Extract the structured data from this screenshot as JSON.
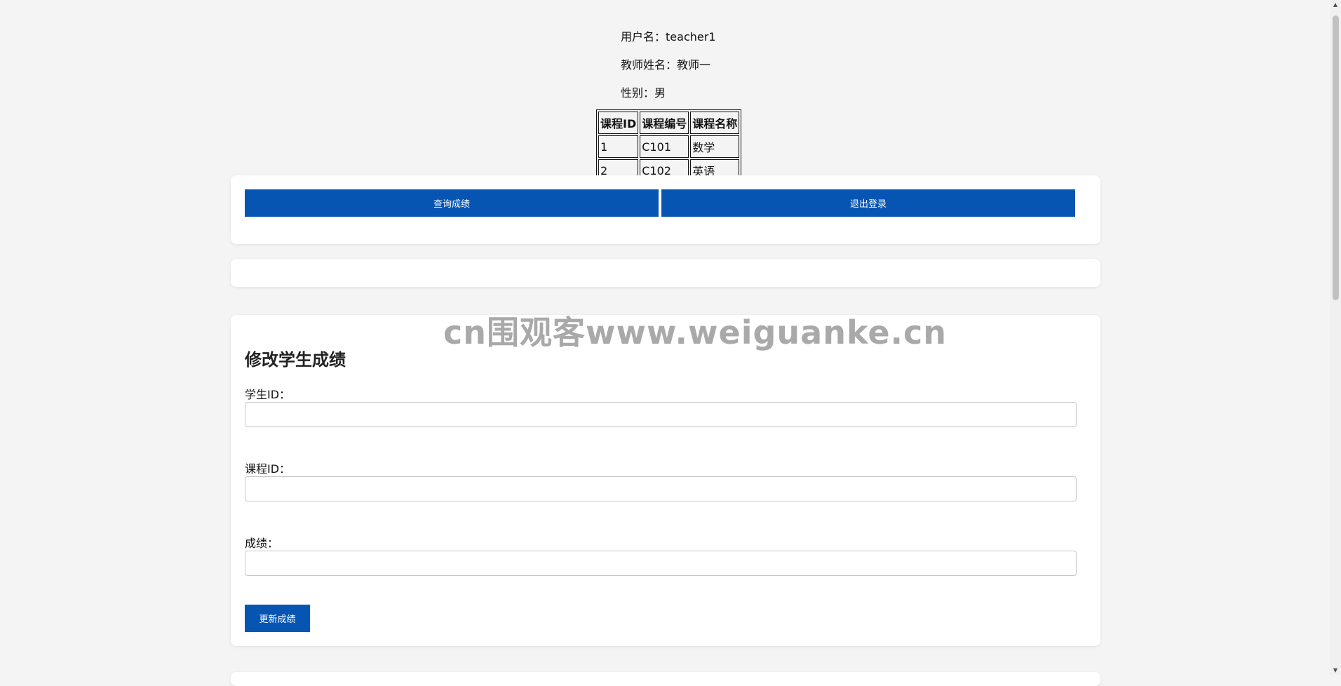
{
  "user": {
    "username_label": "用户名：",
    "username": "teacher1",
    "teacher_name_label": "教师姓名：",
    "teacher_name": "教师一",
    "gender_label": "性别：",
    "gender": "男"
  },
  "courses": {
    "headers": [
      "课程ID",
      "课程编号",
      "课程名称"
    ],
    "rows": [
      [
        "1",
        "C101",
        "数学"
      ],
      [
        "2",
        "C102",
        "英语"
      ]
    ]
  },
  "actions": {
    "query_label": "查询成绩",
    "logout_label": "退出登录"
  },
  "form": {
    "title": "修改学生成绩",
    "student_id_label": "学生ID：",
    "course_id_label": "课程ID：",
    "score_label": "成绩：",
    "student_id_value": "",
    "course_id_value": "",
    "score_value": "",
    "submit_label": "更新成绩"
  },
  "watermark": "cn围观客www.weiguanke.cn",
  "colors": {
    "accent": "#0755b3",
    "background": "#f4f4f4"
  },
  "icons": {
    "scroll_up": "scroll-up-arrow-icon",
    "scroll_down": "scroll-down-arrow-icon"
  }
}
